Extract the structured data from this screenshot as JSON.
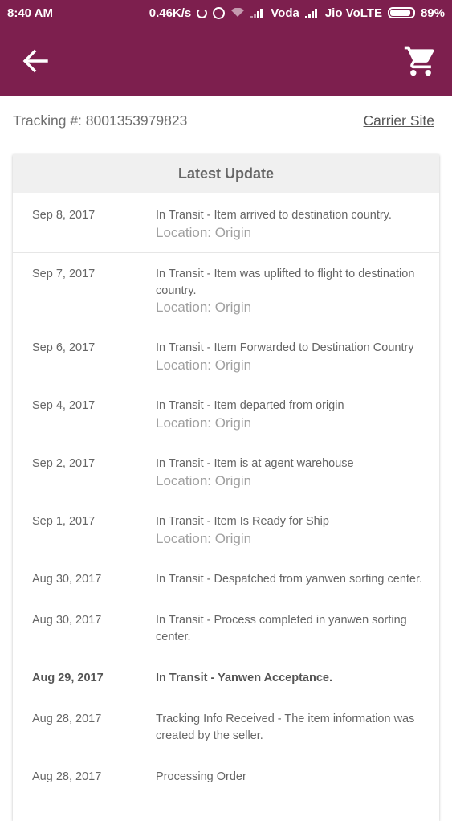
{
  "status_bar": {
    "time": "8:40 AM",
    "speed": "0.46K/s",
    "carrier1": "Voda",
    "carrier2": "Jio VoLTE",
    "battery": "89%",
    "battery_level": 0.89
  },
  "app_bar": {
    "back_icon": "arrow-left-icon",
    "cart_icon": "shopping-cart-icon",
    "color": "#7d1f4e"
  },
  "tracking": {
    "label": "Tracking #: 8001353979823",
    "carrier_link": "Carrier Site"
  },
  "card": {
    "header": "Latest Update",
    "updates": [
      {
        "date": "Sep 8, 2017",
        "status": "In Transit - Item arrived to destination country.",
        "location": "Location: Origin"
      },
      {
        "date": "Sep 7, 2017",
        "status": "In Transit - Item was uplifted to flight to destination country.",
        "location": "Location: Origin"
      },
      {
        "date": "Sep 6, 2017",
        "status": "In Transit - Item Forwarded to Destination Country",
        "location": "Location: Origin"
      },
      {
        "date": "Sep 4, 2017",
        "status": "In Transit - Item departed from origin",
        "location": "Location: Origin"
      },
      {
        "date": "Sep 2, 2017",
        "status": "In Transit - Item is at agent warehouse",
        "location": "Location: Origin"
      },
      {
        "date": "Sep 1, 2017",
        "status": "In Transit - Item Is Ready for Ship",
        "location": "Location: Origin"
      },
      {
        "date": "Aug 30, 2017",
        "status": "In Transit - Despatched from yanwen sorting center.",
        "location": ""
      },
      {
        "date": "Aug 30, 2017",
        "status": "In Transit - Process completed in yanwen sorting center.",
        "location": ""
      },
      {
        "date": "Aug 29, 2017",
        "status": "In Transit - Yanwen Acceptance.",
        "location": ""
      },
      {
        "date": "Aug 28, 2017",
        "status": "Tracking Info Received - The item information was created by the seller.",
        "location": ""
      },
      {
        "date": "Aug 28, 2017",
        "status": "Processing Order",
        "location": ""
      }
    ]
  }
}
